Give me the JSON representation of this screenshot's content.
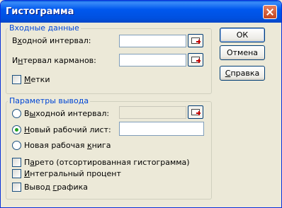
{
  "window": {
    "title": "Гистограмма"
  },
  "input_group": {
    "legend": "Входные данные",
    "input_range_label_pre": "В",
    "input_range_label_u": "х",
    "input_range_label_post": "одной интервал:",
    "input_range_value": "",
    "bin_range_label_pre": "И",
    "bin_range_label_u": "н",
    "bin_range_label_post": "тервал карманов:",
    "bin_range_value": "",
    "labels_checkbox_pre": "",
    "labels_checkbox_u": "М",
    "labels_checkbox_post": "етки"
  },
  "output_group": {
    "legend": "Параметры вывода",
    "output_range_pre": "В",
    "output_range_u": "ы",
    "output_range_post": "ходной интервал:",
    "output_range_value": "",
    "new_sheet_pre": "",
    "new_sheet_u": "Н",
    "new_sheet_post": "овый рабочий лист:",
    "new_sheet_value": "",
    "new_book_pre": "Новая рабочая ",
    "new_book_u": "к",
    "new_book_post": "нига",
    "pareto_pre": "П",
    "pareto_u": "а",
    "pareto_post": "рето (отсортированная гистограмма)",
    "cumulative_pre": "",
    "cumulative_u": "И",
    "cumulative_post": "нтегральный процент",
    "chart_pre": "Вывод ",
    "chart_u": "г",
    "chart_post": "рафика",
    "selected_option": "new_sheet"
  },
  "buttons": {
    "ok": "ОК",
    "cancel": "Отмена",
    "help_u": "С",
    "help_post": "правка"
  }
}
